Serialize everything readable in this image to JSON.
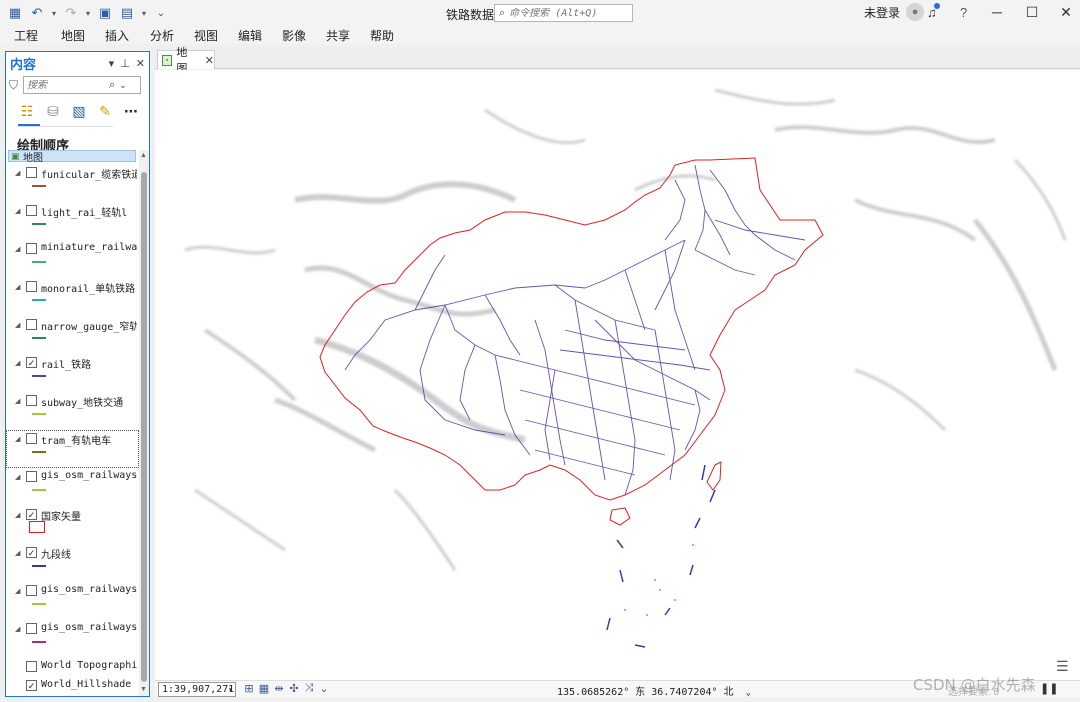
{
  "window": {
    "title": "铁路数据",
    "command_search_placeholder": "命令搜索 (Alt+Q)",
    "user_status": "未登录",
    "help_label": "?",
    "minimize": "─",
    "maximize": "☐",
    "close": "✕"
  },
  "menu": [
    "工程",
    "地图",
    "插入",
    "分析",
    "视图",
    "编辑",
    "影像",
    "共享",
    "帮助"
  ],
  "contents_pane": {
    "title": "内容",
    "search_placeholder": "搜索",
    "section_title": "绘制顺序",
    "map_node": "地图",
    "layers": [
      {
        "name": "funicular_缆索铁道",
        "checked": false,
        "expandable": true,
        "symbol": "line",
        "color": "#a0522d"
      },
      {
        "name": "light_rai_轻轨l",
        "checked": false,
        "expandable": true,
        "symbol": "line",
        "color": "#2e8b57"
      },
      {
        "name": "miniature_railway…",
        "checked": false,
        "expandable": true,
        "symbol": "line",
        "color": "#3cb371"
      },
      {
        "name": "monorail_单轨铁路",
        "checked": false,
        "expandable": true,
        "symbol": "line",
        "color": "#20b2aa"
      },
      {
        "name": "narrow_gauge_窄轨…",
        "checked": false,
        "expandable": true,
        "symbol": "line",
        "color": "#2e8b57"
      },
      {
        "name": "rail_铁路",
        "checked": true,
        "expandable": true,
        "symbol": "line",
        "color": "#5b3fa8"
      },
      {
        "name": "subway_地铁交通",
        "checked": false,
        "expandable": true,
        "symbol": "line",
        "color": "#9acd32"
      },
      {
        "name": "tram_有轨电车",
        "checked": false,
        "expandable": true,
        "symbol": "line",
        "color": "#8b6914"
      },
      {
        "name": "gis_osm_railways_…",
        "checked": false,
        "expandable": true,
        "symbol": "line",
        "color": "#9acd32"
      },
      {
        "name": "国家矢量",
        "checked": true,
        "expandable": true,
        "symbol": "polygon",
        "color": "#e02020"
      },
      {
        "name": "九段线",
        "checked": true,
        "expandable": true,
        "symbol": "line",
        "color": "#3a3a9a"
      },
      {
        "name": "gis_osm_railways_…",
        "checked": false,
        "expandable": true,
        "symbol": "line",
        "color": "#9acd32"
      },
      {
        "name": "gis_osm_railways_…",
        "checked": false,
        "expandable": true,
        "symbol": "line",
        "color": "#b03060"
      },
      {
        "name": "World Topographic…",
        "checked": false,
        "expandable": false,
        "symbol": "none",
        "color": ""
      },
      {
        "name": "World_Hillshade",
        "checked": true,
        "expandable": false,
        "symbol": "none",
        "color": ""
      }
    ]
  },
  "map_tab": {
    "label": "地图"
  },
  "status": {
    "scale": "1:39,907,271",
    "coordinates": "135.0685262° 东  36.7407204° 北",
    "right_text": "选择要素: 0"
  },
  "watermark": "CSDN @白水先森",
  "colors": {
    "accent": "#1e73d8",
    "china_boundary": "#e02020",
    "rail_lines": "#5b3fa8",
    "nine_dash": "#3a3a9a"
  }
}
